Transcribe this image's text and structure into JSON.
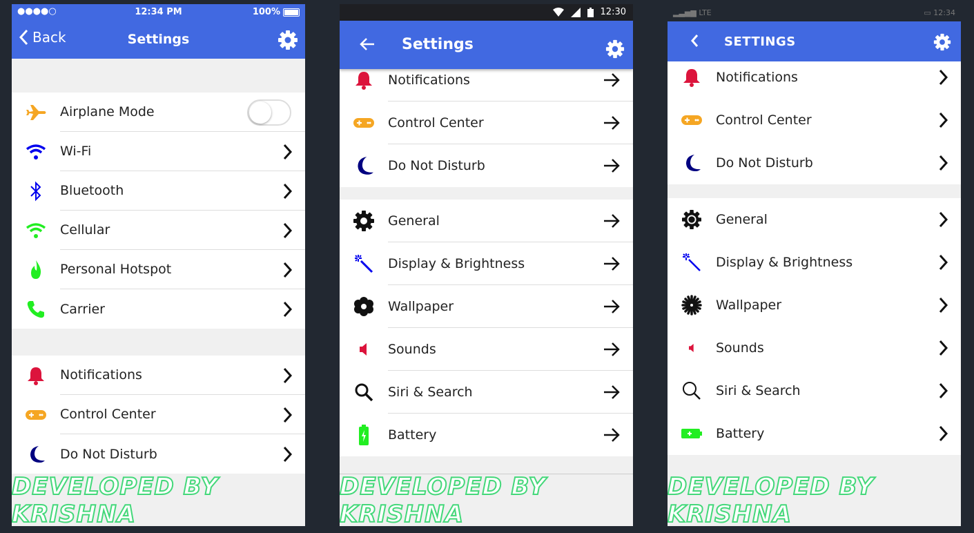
{
  "p1": {
    "status": {
      "left": "●●●●○",
      "time": "12:34 PM",
      "battery": "100%"
    },
    "back": "Back",
    "title": "Settings",
    "group1": [
      {
        "icon": "airplane-icon",
        "label": "Airplane Mode",
        "toggle": false
      },
      {
        "icon": "wifi-icon",
        "label": "Wi-Fi"
      },
      {
        "icon": "bluetooth-icon",
        "label": "Bluetooth"
      },
      {
        "icon": "cellular-icon",
        "label": "Cellular"
      },
      {
        "icon": "hotspot-icon",
        "label": "Personal Hotspot"
      },
      {
        "icon": "phone-icon",
        "label": "Carrier"
      }
    ],
    "group2": [
      {
        "icon": "bell-icon",
        "label": "Notifications"
      },
      {
        "icon": "gamepad-icon",
        "label": "Control Center"
      },
      {
        "icon": "moon-icon",
        "label": "Do Not Disturb"
      }
    ]
  },
  "p2": {
    "status": {
      "time": "12:30"
    },
    "title": "Settings",
    "group1": [
      {
        "icon": "bell-icon",
        "label": "Notifications"
      },
      {
        "icon": "gamepad-icon",
        "label": "Control Center"
      },
      {
        "icon": "moon-icon",
        "label": "Do Not Disturb"
      }
    ],
    "group2": [
      {
        "icon": "gear-icon",
        "label": "General"
      },
      {
        "icon": "magic-wand-icon",
        "label": "Display & Brightness"
      },
      {
        "icon": "flower-icon",
        "label": "Wallpaper"
      },
      {
        "icon": "speaker-icon",
        "label": "Sounds"
      },
      {
        "icon": "search-icon",
        "label": "Siri & Search"
      },
      {
        "icon": "battery-icon",
        "label": "Battery"
      }
    ]
  },
  "p3": {
    "status": {
      "left": "LTE",
      "time": "12:34"
    },
    "title": "SETTINGS",
    "group1": [
      {
        "icon": "bell-icon",
        "label": "Notifications"
      },
      {
        "icon": "gamepad-icon",
        "label": "Control Center"
      },
      {
        "icon": "moon-icon",
        "label": "Do Not Disturb"
      }
    ],
    "group2": [
      {
        "icon": "gear-icon",
        "label": "General"
      },
      {
        "icon": "magic-wand-icon",
        "label": "Display & Brightness"
      },
      {
        "icon": "burst-icon",
        "label": "Wallpaper"
      },
      {
        "icon": "speaker-icon",
        "label": "Sounds"
      },
      {
        "icon": "search-icon",
        "label": "Siri & Search"
      },
      {
        "icon": "battery-icon",
        "label": "Battery"
      }
    ]
  },
  "footer": "DEVELOPED BY KRISHNA",
  "colors": {
    "accent": "#4169e1",
    "airplane": "#f5a623",
    "wifi": "#0000ee",
    "green": "#22ee22",
    "red": "#dc143c",
    "orange": "#f5a623",
    "navy": "#000080"
  }
}
